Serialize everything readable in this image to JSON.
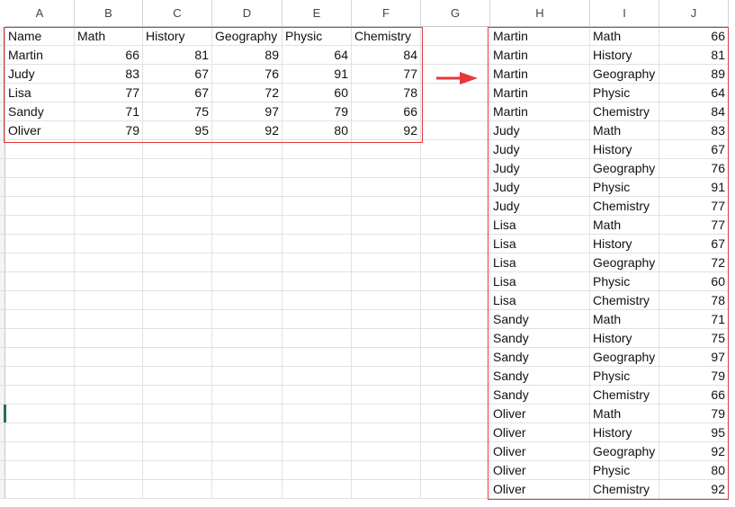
{
  "columns": [
    "A",
    "B",
    "C",
    "D",
    "E",
    "F",
    "G",
    "H",
    "I",
    "J"
  ],
  "left_table": {
    "header": [
      "Name",
      "Math",
      "History",
      "Geography",
      "Physic",
      "Chemistry"
    ],
    "rows": [
      [
        "Martin",
        66,
        81,
        89,
        64,
        84
      ],
      [
        "Judy",
        83,
        67,
        76,
        91,
        77
      ],
      [
        "Lisa",
        77,
        67,
        72,
        60,
        78
      ],
      [
        "Sandy",
        71,
        75,
        97,
        79,
        66
      ],
      [
        "Oliver",
        79,
        95,
        92,
        80,
        92
      ]
    ]
  },
  "right_table": {
    "rows": [
      [
        "Martin",
        "Math",
        66
      ],
      [
        "Martin",
        "History",
        81
      ],
      [
        "Martin",
        "Geography",
        89
      ],
      [
        "Martin",
        "Physic",
        64
      ],
      [
        "Martin",
        "Chemistry",
        84
      ],
      [
        "Judy",
        "Math",
        83
      ],
      [
        "Judy",
        "History",
        67
      ],
      [
        "Judy",
        "Geography",
        76
      ],
      [
        "Judy",
        "Physic",
        91
      ],
      [
        "Judy",
        "Chemistry",
        77
      ],
      [
        "Lisa",
        "Math",
        77
      ],
      [
        "Lisa",
        "History",
        67
      ],
      [
        "Lisa",
        "Geography",
        72
      ],
      [
        "Lisa",
        "Physic",
        60
      ],
      [
        "Lisa",
        "Chemistry",
        78
      ],
      [
        "Sandy",
        "Math",
        71
      ],
      [
        "Sandy",
        "History",
        75
      ],
      [
        "Sandy",
        "Geography",
        97
      ],
      [
        "Sandy",
        "Physic",
        79
      ],
      [
        "Sandy",
        "Chemistry",
        66
      ],
      [
        "Oliver",
        "Math",
        79
      ],
      [
        "Oliver",
        "History",
        95
      ],
      [
        "Oliver",
        "Geography",
        92
      ],
      [
        "Oliver",
        "Physic",
        80
      ],
      [
        "Oliver",
        "Chemistry",
        92
      ]
    ]
  },
  "colors": {
    "highlight_border": "#e5383b",
    "arrow": "#e5383b",
    "selection_mark": "#217346"
  },
  "icons": {
    "arrow": "right-arrow-icon"
  }
}
